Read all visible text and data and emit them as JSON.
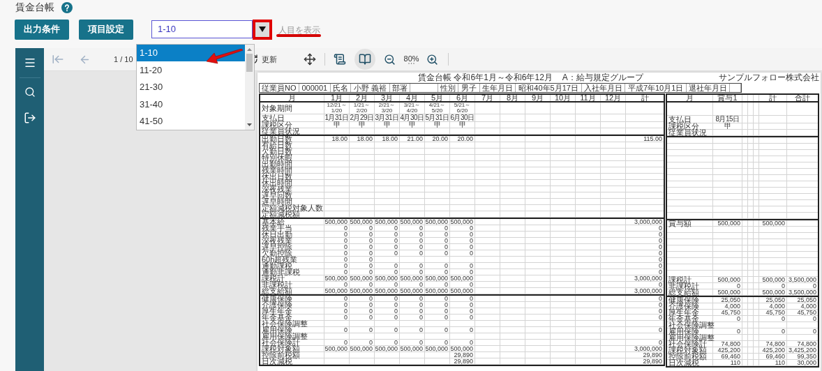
{
  "page": {
    "title": "賃金台帳"
  },
  "actions": [
    {
      "label": "出力条件"
    },
    {
      "label": "項目設定"
    }
  ],
  "range_select": {
    "value": "1-10",
    "suffix": "人目を表示",
    "options": [
      {
        "label": "1-10",
        "selected": true
      },
      {
        "label": "11-20",
        "selected": false
      },
      {
        "label": "21-30",
        "selected": false
      },
      {
        "label": "31-40",
        "selected": false
      },
      {
        "label": "41-50",
        "selected": false
      }
    ]
  },
  "toolbar": {
    "page": "1 / 10",
    "refresh": "更新",
    "zoom": "80%",
    "view_modes": [
      {
        "selected": false
      },
      {
        "selected": true
      }
    ]
  },
  "report": {
    "title": "賃金台帳 令和6年1月～令和6年12月",
    "group": "A：給与規定グループ",
    "company": "サンプルフォロー株式会社",
    "employee": [
      {
        "label": "従業員NO",
        "value": "000001"
      },
      {
        "label": "氏名",
        "value": "小野 義裕"
      },
      {
        "label": "部署"
      },
      {
        "label": "性別",
        "value": "男子"
      },
      {
        "label": "生年月日",
        "value": "昭和40年5月17日"
      },
      {
        "label": "入社年月日",
        "value": "平成7年10月1日"
      },
      {
        "label": "退社年月日"
      }
    ],
    "monthly": {
      "columns": [
        "月",
        "1月",
        "2月",
        "3月",
        "4月",
        "5月",
        "6月",
        "7月",
        "8月",
        "9月",
        "10月",
        "11月",
        "12月",
        "計"
      ],
      "sections": [
        {
          "rows": [
            {
              "label": "対象期間",
              "kind": "period",
              "cells": [
                "12/21～1/20",
                "1/21～2/20",
                "2/21～3/20",
                "3/21～4/20",
                "4/21～5/20",
                "5/21～6/20"
              ]
            },
            {
              "label": "支払日",
              "kind": "text",
              "cells": [
                "1月31日",
                "2月29日",
                "3月31日",
                "4月30日",
                "5月31日",
                "6月30日"
              ]
            },
            {
              "label": "課税区分",
              "kind": "text",
              "cells": [
                "甲",
                "甲",
                "甲",
                "甲",
                "甲",
                "甲"
              ]
            },
            {
              "label": "従業員状況",
              "kind": "text"
            }
          ]
        },
        {
          "rows": [
            {
              "label": "出勤日数",
              "kind": "number",
              "cells": [
                "18.00",
                "18.00",
                "18.00",
                "21.00",
                "20.00",
                "20.00",
                null,
                null,
                null,
                null,
                null,
                null,
                "115.00"
              ]
            },
            {
              "label": "有給日数",
              "kind": "number"
            },
            {
              "label": "欠勤日数",
              "kind": "number"
            },
            {
              "label": "特別休暇",
              "kind": "number"
            },
            {
              "label": "出勤時間",
              "kind": "number"
            },
            {
              "label": "残業時間",
              "kind": "number"
            },
            {
              "label": "休出日数",
              "kind": "number"
            },
            {
              "label": "休出時間",
              "kind": "number"
            },
            {
              "label": "深夜残業",
              "kind": "number"
            },
            {
              "label": "遅早回数",
              "kind": "number"
            },
            {
              "label": "遅早時間",
              "kind": "number"
            },
            {
              "label": "定額減税対象人数",
              "kind": "number"
            },
            {
              "label": "定額減税額",
              "kind": "number"
            }
          ]
        },
        {
          "rows": [
            {
              "label": "基本給",
              "kind": "number",
              "cells": [
                "500,000",
                "500,000",
                "500,000",
                "500,000",
                "500,000",
                "500,000",
                null,
                null,
                null,
                null,
                null,
                null,
                "3,000,000"
              ]
            },
            {
              "label": "残業手当",
              "kind": "number",
              "cells": [
                "0",
                "0",
                "0",
                "0",
                "0",
                "0",
                null,
                null,
                null,
                null,
                null,
                null,
                "0"
              ]
            },
            {
              "label": "休日出勤",
              "kind": "number",
              "cells": [
                "0",
                "0",
                "0",
                "0",
                "0",
                "0",
                null,
                null,
                null,
                null,
                null,
                null,
                "0"
              ]
            },
            {
              "label": "深夜残業",
              "kind": "number",
              "cells": [
                "0",
                "0",
                "0",
                "0",
                "0",
                "0",
                null,
                null,
                null,
                null,
                null,
                null,
                "0"
              ]
            },
            {
              "label": "遅早控除",
              "kind": "number",
              "cells": [
                "0",
                "0",
                "0",
                "0",
                "0",
                "0",
                null,
                null,
                null,
                null,
                null,
                null,
                "0"
              ]
            },
            {
              "label": "欠勤控除",
              "kind": "number",
              "cells": [
                "0",
                "0",
                "0",
                "0",
                "0",
                "0",
                null,
                null,
                null,
                null,
                null,
                null,
                "0"
              ]
            },
            {
              "label": "60h超残業",
              "kind": "number",
              "cells": [
                "0",
                "0",
                null,
                null,
                null,
                null,
                null,
                null,
                null,
                null,
                null,
                null,
                "0"
              ]
            },
            {
              "label": "通勤課税",
              "kind": "number",
              "cells": [
                "0",
                "0",
                "0",
                "0",
                "0",
                "0",
                null,
                null,
                null,
                null,
                null,
                null,
                "0"
              ]
            },
            {
              "label": "通勤非課税",
              "kind": "number",
              "cells": [
                "0",
                "0",
                "0",
                "0",
                "0",
                "0",
                null,
                null,
                null,
                null,
                null,
                null,
                "0"
              ]
            },
            {
              "label": "課税計",
              "kind": "number",
              "cells": [
                "500,000",
                "500,000",
                "500,000",
                "500,000",
                "500,000",
                "500,000",
                null,
                null,
                null,
                null,
                null,
                null,
                "3,000,000"
              ]
            },
            {
              "label": "非課税計",
              "kind": "number",
              "cells": [
                "0",
                "0",
                "0",
                "0",
                "0",
                "0",
                null,
                null,
                null,
                null,
                null,
                null,
                "0"
              ]
            },
            {
              "label": "総支給額",
              "kind": "number",
              "cells": [
                "500,000",
                "500,000",
                "500,000",
                "500,000",
                "500,000",
                "500,000",
                null,
                null,
                null,
                null,
                null,
                null,
                "3,000,000"
              ]
            }
          ]
        },
        {
          "rows": [
            {
              "label": "健康保険",
              "kind": "number",
              "cells": [
                "0",
                "0",
                "0",
                "0",
                "0",
                "0",
                null,
                null,
                null,
                null,
                null,
                null,
                "0"
              ]
            },
            {
              "label": "介護保険",
              "kind": "number",
              "cells": [
                "0",
                "0",
                "0",
                "0",
                "0",
                "0",
                null,
                null,
                null,
                null,
                null,
                null,
                "0"
              ]
            },
            {
              "label": "厚生年金",
              "kind": "number",
              "cells": [
                "0",
                "0",
                "0",
                "0",
                "0",
                "0",
                null,
                null,
                null,
                null,
                null,
                null,
                "0"
              ]
            },
            {
              "label": "年金基金",
              "kind": "number",
              "cells": [
                "0",
                "0",
                "0",
                "0",
                "0",
                "0",
                null,
                null,
                null,
                null,
                null,
                null,
                "0"
              ]
            },
            {
              "label": "社会保険調整",
              "kind": "number"
            },
            {
              "label": "雇用保険",
              "kind": "number",
              "cells": [
                "0",
                "0",
                "0",
                "0",
                "0",
                "0",
                null,
                null,
                null,
                null,
                null,
                null,
                "0"
              ]
            },
            {
              "label": "雇用保険調整",
              "kind": "number"
            },
            {
              "label": "社会保険計",
              "kind": "number",
              "cells": [
                "0",
                "0",
                "0",
                "0",
                "0",
                "0",
                null,
                null,
                null,
                null,
                null,
                null,
                "0"
              ]
            },
            {
              "label": "課税対象額",
              "kind": "number",
              "cells": [
                "500,000",
                "500,000",
                "500,000",
                "500,000",
                "500,000",
                "500,000",
                null,
                null,
                null,
                null,
                null,
                null,
                "3,000,000"
              ]
            },
            {
              "label": "控除前税額",
              "kind": "number",
              "cells": [
                null,
                null,
                null,
                null,
                null,
                "29,890",
                null,
                null,
                null,
                null,
                null,
                null,
                "29,890"
              ]
            },
            {
              "label": "日次減税",
              "kind": "number",
              "cells": [
                null,
                null,
                null,
                null,
                null,
                "29,890",
                null,
                null,
                null,
                null,
                null,
                null,
                "29,890"
              ]
            }
          ]
        }
      ]
    },
    "bonus": {
      "columns": [
        "月",
        "賞与1",
        null,
        null,
        null,
        "計",
        "合計"
      ],
      "sections": [
        {
          "rows": [
            null,
            {
              "label": "支払日",
              "kind": "text",
              "cells": [
                "8月15日"
              ]
            },
            {
              "label": "課税区分",
              "kind": "text",
              "cells": [
                "甲"
              ]
            },
            {
              "label": "従業員状況",
              "kind": "text"
            }
          ]
        },
        {
          "rows": [
            null,
            null,
            null,
            null,
            null,
            null,
            null,
            null,
            null,
            null,
            null,
            null,
            null
          ]
        },
        {
          "rows": [
            {
              "label": "賞与額",
              "kind": "number",
              "cells": [
                "500,000",
                null,
                null,
                null,
                "500,000"
              ]
            },
            null,
            null,
            null,
            null,
            null,
            null,
            null,
            null,
            {
              "label": "課税計",
              "kind": "number",
              "cells": [
                "500,000",
                null,
                null,
                null,
                "500,000",
                "3,500,000"
              ]
            },
            {
              "label": "非課税計",
              "kind": "number",
              "cells": [
                "0",
                null,
                null,
                null,
                "0",
                "0"
              ]
            },
            {
              "label": "総支給額",
              "kind": "number",
              "cells": [
                "500,000",
                null,
                null,
                null,
                "500,000",
                "3,500,000"
              ]
            }
          ]
        },
        {
          "rows": [
            {
              "label": "健康保険",
              "kind": "number",
              "cells": [
                "25,050",
                null,
                null,
                null,
                "25,050",
                "25,050"
              ]
            },
            {
              "label": "介護保険",
              "kind": "number",
              "cells": [
                "4,000",
                null,
                null,
                null,
                "4,000",
                "4,000"
              ]
            },
            {
              "label": "厚生年金",
              "kind": "number",
              "cells": [
                "45,750",
                null,
                null,
                null,
                "45,750",
                "45,750"
              ]
            },
            {
              "label": "年金基金",
              "kind": "number",
              "cells": [
                "0",
                null,
                null,
                null,
                "0",
                "0"
              ]
            },
            {
              "label": "社会保険調整",
              "kind": "number"
            },
            {
              "label": "雇用保険",
              "kind": "number",
              "cells": [
                "0",
                null,
                null,
                null,
                "0",
                "0"
              ]
            },
            {
              "label": "雇用保険調整",
              "kind": "number"
            },
            {
              "label": "社会保険計",
              "kind": "number",
              "cells": [
                "74,800",
                null,
                null,
                null,
                "74,800",
                "74,800"
              ]
            },
            {
              "label": "課税対象額",
              "kind": "number",
              "cells": [
                "425,200",
                null,
                null,
                null,
                "425,200",
                "3,425,200"
              ]
            },
            {
              "label": "控除前税額",
              "kind": "number",
              "cells": [
                "69,460",
                null,
                null,
                null,
                "69,460",
                "99,350"
              ]
            },
            {
              "label": "日次減税",
              "kind": "number",
              "cells": [
                "110",
                null,
                null,
                null,
                "110",
                "30,000"
              ]
            }
          ]
        }
      ]
    }
  }
}
